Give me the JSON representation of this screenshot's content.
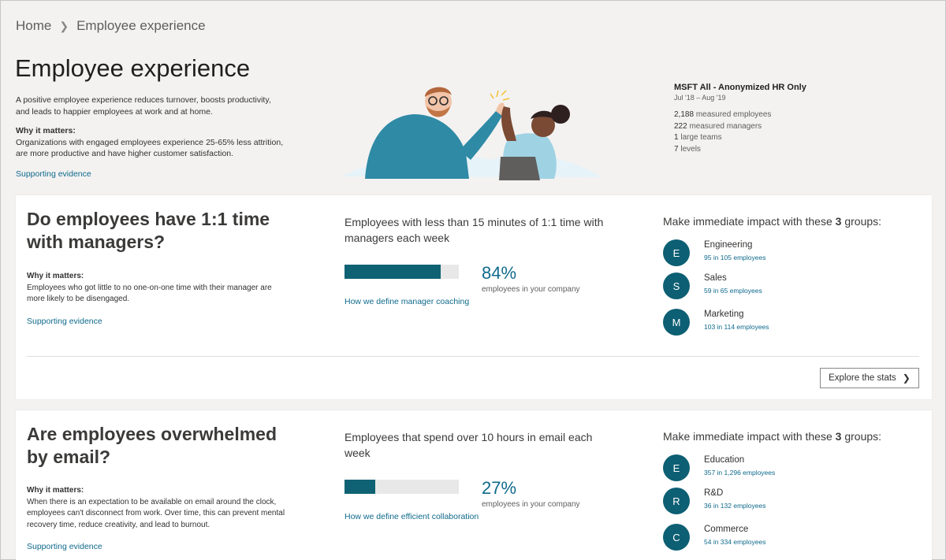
{
  "breadcrumb": {
    "home": "Home",
    "current": "Employee experience"
  },
  "page": {
    "title": "Employee experience",
    "intro": "A positive employee experience reduces turnover, boosts productivity, and leads to happier employees at work and at home.",
    "why_label": "Why it matters:",
    "why_text": "Organizations with engaged employees experience 25-65% less attrition, are more productive and have higher customer satisfaction.",
    "supporting_link": "Supporting evidence"
  },
  "org": {
    "name": "MSFT All - Anonymized HR Only",
    "dates": "Jul '18 – Aug '19",
    "stats": [
      {
        "value": "2,188",
        "label": "measured employees"
      },
      {
        "value": "222",
        "label": "measured managers"
      },
      {
        "value": "1",
        "label": "large teams"
      },
      {
        "value": "7",
        "label": "levels"
      }
    ]
  },
  "cards": [
    {
      "question": "Do employees have 1:1 time with managers?",
      "why_label": "Why it matters:",
      "why_text": "Employees who got little to no one-on-one time with their manager are more likely to be disengaged.",
      "supporting_link": "Supporting evidence",
      "metric_title": "Employees with less than 15 minutes of 1:1 time with managers each week",
      "percent": "84%",
      "percent_value": 0.84,
      "percent_sub": "employees in your company",
      "define_link": "How we define manager coaching",
      "groups_title_pre": "Make immediate impact with these",
      "groups_count": "3",
      "groups_title_post": "groups:",
      "groups": [
        {
          "initial": "E",
          "name": "Engineering",
          "count": "95 in 105 employees"
        },
        {
          "initial": "S",
          "name": "Sales",
          "count": "59 in 65 employees"
        },
        {
          "initial": "M",
          "name": "Marketing",
          "count": "103 in 114 employees"
        }
      ],
      "explore_button": "Explore the stats"
    },
    {
      "question": "Are employees overwhelmed by email?",
      "why_label": "Why it matters:",
      "why_text": "When there is an expectation to be available on email around the clock, employees can't disconnect from work. Over time, this can prevent mental recovery time, reduce creativity, and lead to burnout.",
      "supporting_link": "Supporting evidence",
      "metric_title": "Employees that spend over 10 hours in email each week",
      "percent": "27%",
      "percent_value": 0.27,
      "percent_sub": "employees in your company",
      "define_link": "How we define efficient collaboration",
      "groups_title_pre": "Make immediate impact with these",
      "groups_count": "3",
      "groups_title_post": "groups:",
      "groups": [
        {
          "initial": "E",
          "name": "Education",
          "count": "357 in 1,296 employees"
        },
        {
          "initial": "R",
          "name": "R&D",
          "count": "36 in 132 employees"
        },
        {
          "initial": "C",
          "name": "Commerce",
          "count": "54 in 334 employees"
        }
      ]
    }
  ],
  "colors": {
    "accent": "#0f6a8c",
    "avatar": "#0d5f73",
    "bar": "#0f6273"
  },
  "icons": {
    "breadcrumb_sep": "chevron-right-icon",
    "explore": "chevron-right-icon"
  }
}
